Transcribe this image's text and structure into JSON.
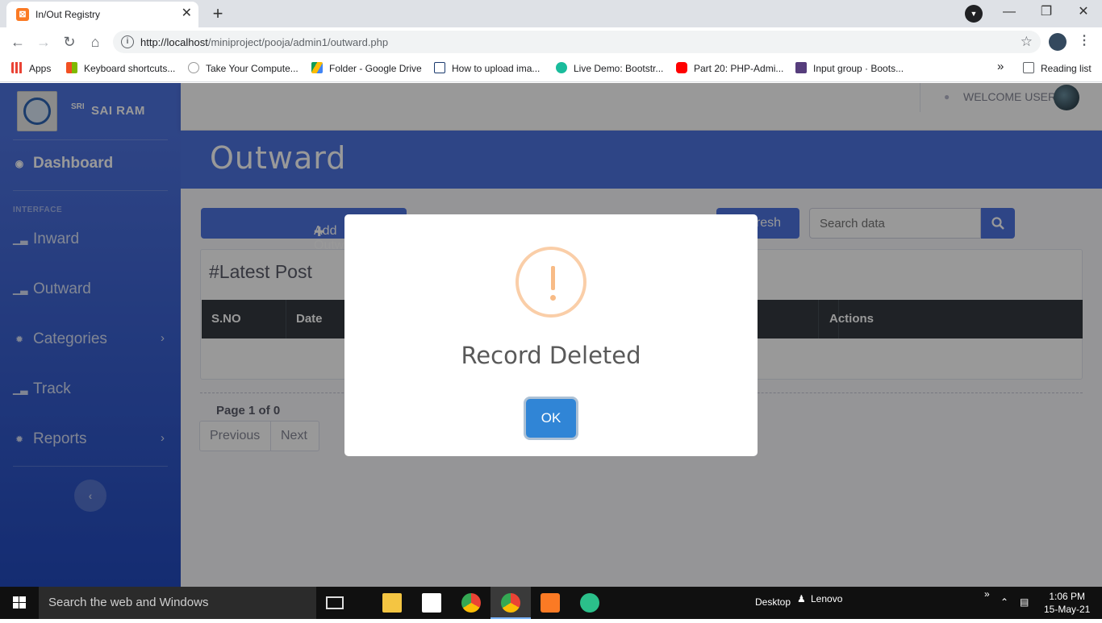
{
  "browser": {
    "tab_title": "In/Out Registry",
    "tab_close": "✕",
    "new_tab": "+",
    "url_host": "http://localhost",
    "url_path": "/miniproject/pooja/admin1/outward.php",
    "bookmarks": [
      {
        "label": "Apps",
        "color": "#ea4335"
      },
      {
        "label": "Keyboard shortcuts...",
        "color": "#f25022"
      },
      {
        "label": "Take Your Compute...",
        "color": "#ffffff"
      },
      {
        "label": "Folder - Google Drive",
        "color": "#fbbc04"
      },
      {
        "label": "How to upload ima...",
        "color": "#ffffff"
      },
      {
        "label": "Live Demo: Bootstr...",
        "color": "#1abc9c"
      },
      {
        "label": "Part 20: PHP-Admi...",
        "color": "#ff0000"
      },
      {
        "label": "Input group · Boots...",
        "color": "#563d7c"
      }
    ],
    "more_bookmarks": "»",
    "reading_list": "Reading list"
  },
  "sidebar": {
    "brand_sup": "SRI",
    "brand_name": "SAI RAM",
    "dashboard": "Dashboard",
    "heading": "INTERFACE",
    "items": [
      {
        "label": "Inward"
      },
      {
        "label": "Outward"
      },
      {
        "label": "Categories"
      },
      {
        "label": "Track"
      },
      {
        "label": "Reports"
      }
    ],
    "toggle": "‹"
  },
  "topbar": {
    "welcome": "WELCOME USER"
  },
  "page": {
    "title": "Outward",
    "add_button": "Add Outward",
    "refresh_button": "Refresh",
    "search_placeholder": "Search data",
    "card_title": "#Latest Post",
    "table_headers": [
      "S.NO",
      "Date",
      "",
      "",
      "",
      "Actions"
    ],
    "page_info": "Page 1 of 0",
    "prev": "Previous",
    "next": "Next"
  },
  "modal": {
    "icon": "warning-icon",
    "title": "Record Deleted",
    "ok": "OK"
  },
  "taskbar": {
    "search": "Search the web and Windows",
    "desktop": "Desktop",
    "user": "Lenovo",
    "time": "1:06 PM",
    "date": "15-May-21"
  },
  "colors": {
    "primary": "#4e73df",
    "ok_button": "#3085d6",
    "warning": "#f8bb86"
  }
}
